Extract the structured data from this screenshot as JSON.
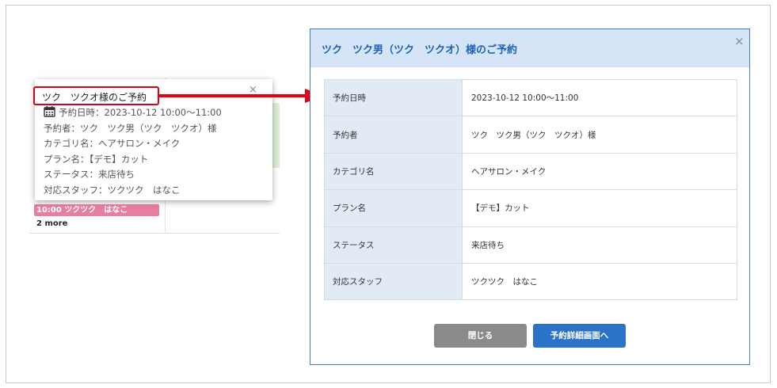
{
  "calendar": {
    "event_label": "10:00 ツクツク　はなこ",
    "more_label": "2 more"
  },
  "popup": {
    "title": "ツク　ツクオ様のご予約",
    "close_glyph": "×",
    "lines": [
      "予約日時：2023-10-12 10:00～11:00",
      "予約者：ツク　ツク男（ツク　ツクオ）様",
      "カテゴリ名：ヘアサロン・メイク",
      "プラン名：【デモ】カット",
      "ステータス：来店待ち",
      "対応スタッフ：ツクツク　はなこ"
    ]
  },
  "modal": {
    "title": "ツク　ツク男（ツク　ツクオ）様のご予約",
    "close_glyph": "×",
    "rows": [
      {
        "label": "予約日時",
        "value": "2023-10-12 10:00～11:00"
      },
      {
        "label": "予約者",
        "value": "ツク　ツク男（ツク　ツクオ）様"
      },
      {
        "label": "カテゴリ名",
        "value": "ヘアサロン・メイク"
      },
      {
        "label": "プラン名",
        "value": "【デモ】カット"
      },
      {
        "label": "ステータス",
        "value": "来店待ち"
      },
      {
        "label": "対応スタッフ",
        "value": "ツクツク　はなこ"
      }
    ],
    "buttons": {
      "close_label": "閉じる",
      "detail_label": "予約詳細画面へ"
    }
  },
  "colors": {
    "highlight_red": "#d9001b",
    "modal_header_bg": "#d6e4f7",
    "modal_title": "#1a63b8",
    "primary_button": "#2d72c9",
    "secondary_button": "#8a8a8a",
    "event_pink": "#e77fa0"
  }
}
